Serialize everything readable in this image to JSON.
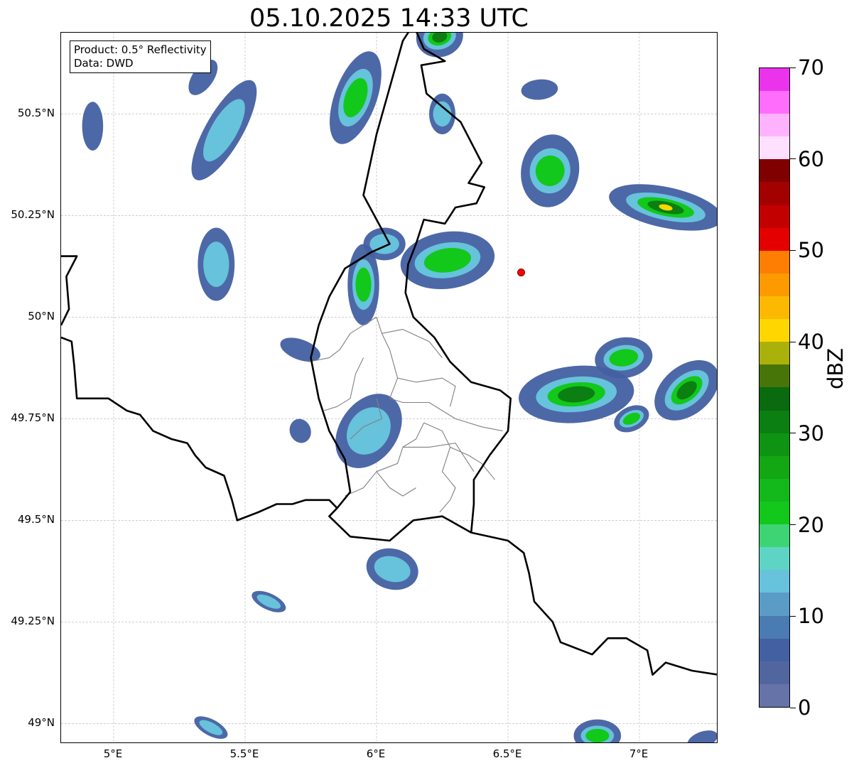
{
  "title": "05.10.2025 14:33 UTC",
  "info": {
    "product": "Product: 0.5° Reflectivity",
    "data": "Data: DWD"
  },
  "axes": {
    "lat_labels": [
      "50.5°N",
      "50.25°N",
      "50°N",
      "49.75°N",
      "49.5°N",
      "49.25°N",
      "49°N"
    ],
    "lon_labels": [
      "5°E",
      "5.5°E",
      "6°E",
      "6.5°E",
      "7°E"
    ],
    "lat_values": [
      50.5,
      50.25,
      50.0,
      49.75,
      49.5,
      49.25,
      49.0
    ],
    "lon_values": [
      5.0,
      5.5,
      6.0,
      6.5,
      7.0
    ],
    "extent": {
      "lon_min": 4.8,
      "lon_max": 7.3,
      "lat_min": 48.95,
      "lat_max": 50.7
    },
    "grid": true
  },
  "colorbar": {
    "unit": "dBZ",
    "tick_labels": [
      "0",
      "10",
      "20",
      "30",
      "40",
      "50",
      "60",
      "70"
    ],
    "tick_values": [
      0,
      10,
      20,
      30,
      40,
      50,
      60,
      70
    ],
    "range": [
      0,
      70
    ],
    "colors": [
      "#6673a8",
      "#51669f",
      "#4360a2",
      "#4a7bb2",
      "#5b9cc7",
      "#67c2dc",
      "#5ed5c4",
      "#3dd474",
      "#12c81a",
      "#13b81a",
      "#12a713",
      "#0e9313",
      "#0b7f12",
      "#096a0e",
      "#487508",
      "#abb10b",
      "#fed700",
      "#fdb901",
      "#fd9a00",
      "#fd7e02",
      "#e50000",
      "#c20000",
      "#a30000",
      "#800000",
      "#ffe1ff",
      "#ffb3fe",
      "#ff6dfd",
      "#eb33ee"
    ]
  },
  "station": {
    "lat": 50.11,
    "lon": 6.55,
    "color": "#ff0000"
  },
  "echoes": [
    {
      "lon": 6.24,
      "lat": 50.69,
      "rx": 0.09,
      "ry": 0.05,
      "angle": -15,
      "dbz": 28
    },
    {
      "lon": 5.34,
      "lat": 50.59,
      "rx": 0.04,
      "ry": 0.05,
      "angle": 35,
      "dbz": 8
    },
    {
      "lon": 4.92,
      "lat": 50.47,
      "rx": 0.04,
      "ry": 0.06,
      "angle": 0,
      "dbz": 10
    },
    {
      "lon": 5.42,
      "lat": 50.46,
      "rx": 0.07,
      "ry": 0.14,
      "angle": 30,
      "dbz": 14
    },
    {
      "lon": 5.92,
      "lat": 50.54,
      "rx": 0.08,
      "ry": 0.12,
      "angle": 20,
      "dbz": 22
    },
    {
      "lon": 6.25,
      "lat": 50.5,
      "rx": 0.05,
      "ry": 0.05,
      "angle": 0,
      "dbz": 12
    },
    {
      "lon": 6.62,
      "lat": 50.56,
      "rx": 0.07,
      "ry": 0.025,
      "angle": -5,
      "dbz": 8
    },
    {
      "lon": 6.66,
      "lat": 50.36,
      "rx": 0.11,
      "ry": 0.09,
      "angle": 10,
      "dbz": 20
    },
    {
      "lon": 7.1,
      "lat": 50.27,
      "rx": 0.22,
      "ry": 0.05,
      "angle": 12,
      "dbz": 32
    },
    {
      "lon": 5.39,
      "lat": 50.13,
      "rx": 0.07,
      "ry": 0.09,
      "angle": 0,
      "dbz": 12
    },
    {
      "lon": 5.95,
      "lat": 50.08,
      "rx": 0.06,
      "ry": 0.1,
      "angle": 0,
      "dbz": 24
    },
    {
      "lon": 6.27,
      "lat": 50.14,
      "rx": 0.18,
      "ry": 0.07,
      "angle": -8,
      "dbz": 26
    },
    {
      "lon": 6.03,
      "lat": 50.18,
      "rx": 0.08,
      "ry": 0.04,
      "angle": 0,
      "dbz": 18
    },
    {
      "lon": 5.71,
      "lat": 49.92,
      "rx": 0.08,
      "ry": 0.025,
      "angle": 20,
      "dbz": 10
    },
    {
      "lon": 5.97,
      "lat": 49.72,
      "rx": 0.11,
      "ry": 0.1,
      "angle": 35,
      "dbz": 16
    },
    {
      "lon": 5.71,
      "lat": 49.72,
      "rx": 0.04,
      "ry": 0.03,
      "angle": -20,
      "dbz": 10
    },
    {
      "lon": 6.76,
      "lat": 49.81,
      "rx": 0.22,
      "ry": 0.07,
      "angle": -5,
      "dbz": 30
    },
    {
      "lon": 6.94,
      "lat": 49.9,
      "rx": 0.11,
      "ry": 0.05,
      "angle": -8,
      "dbz": 20
    },
    {
      "lon": 7.18,
      "lat": 49.82,
      "rx": 0.14,
      "ry": 0.06,
      "angle": -40,
      "dbz": 30
    },
    {
      "lon": 6.97,
      "lat": 49.75,
      "rx": 0.07,
      "ry": 0.03,
      "angle": -25,
      "dbz": 26
    },
    {
      "lon": 6.06,
      "lat": 49.38,
      "rx": 0.1,
      "ry": 0.05,
      "angle": 15,
      "dbz": 16
    },
    {
      "lon": 5.59,
      "lat": 49.3,
      "rx": 0.07,
      "ry": 0.02,
      "angle": 25,
      "dbz": 12
    },
    {
      "lon": 5.37,
      "lat": 48.99,
      "rx": 0.07,
      "ry": 0.02,
      "angle": 28,
      "dbz": 18
    },
    {
      "lon": 6.84,
      "lat": 48.97,
      "rx": 0.09,
      "ry": 0.04,
      "angle": 0,
      "dbz": 20
    },
    {
      "lon": 7.24,
      "lat": 48.96,
      "rx": 0.06,
      "ry": 0.02,
      "angle": -20,
      "dbz": 10
    }
  ],
  "borders": {
    "national": [
      [
        [
          6.14,
          50.72
        ],
        [
          6.18,
          50.66
        ],
        [
          6.26,
          50.63
        ],
        [
          6.17,
          50.62
        ],
        [
          6.19,
          50.55
        ],
        [
          6.32,
          50.48
        ],
        [
          6.4,
          50.38
        ],
        [
          6.35,
          50.33
        ],
        [
          6.41,
          50.32
        ],
        [
          6.38,
          50.28
        ],
        [
          6.3,
          50.27
        ],
        [
          6.26,
          50.23
        ],
        [
          6.18,
          50.24
        ],
        [
          6.15,
          50.18
        ],
        [
          6.12,
          50.13
        ],
        [
          6.11,
          50.06
        ],
        [
          6.14,
          50.0
        ],
        [
          6.22,
          49.95
        ],
        [
          6.28,
          49.89
        ],
        [
          6.36,
          49.84
        ],
        [
          6.47,
          49.82
        ],
        [
          6.51,
          49.8
        ],
        [
          6.5,
          49.72
        ],
        [
          6.43,
          49.66
        ],
        [
          6.37,
          49.6
        ],
        [
          6.37,
          49.54
        ],
        [
          6.36,
          49.47
        ]
      ],
      [
        [
          6.14,
          50.72
        ],
        [
          6.1,
          50.68
        ],
        [
          6.0,
          50.45
        ],
        [
          5.95,
          50.3
        ],
        [
          6.05,
          50.18
        ],
        [
          5.98,
          50.16
        ],
        [
          5.88,
          50.12
        ],
        [
          5.82,
          50.05
        ],
        [
          5.78,
          49.98
        ],
        [
          5.75,
          49.9
        ],
        [
          5.78,
          49.8
        ],
        [
          5.82,
          49.72
        ],
        [
          5.88,
          49.65
        ],
        [
          5.9,
          49.57
        ],
        [
          5.85,
          49.53
        ],
        [
          5.82,
          49.51
        ],
        [
          5.9,
          49.46
        ],
        [
          6.05,
          49.45
        ],
        [
          6.14,
          49.5
        ],
        [
          6.25,
          49.51
        ],
        [
          6.36,
          49.47
        ],
        [
          6.5,
          49.45
        ],
        [
          6.56,
          49.42
        ],
        [
          6.58,
          49.37
        ],
        [
          6.6,
          49.3
        ],
        [
          6.67,
          49.25
        ],
        [
          6.7,
          49.2
        ],
        [
          6.82,
          49.17
        ],
        [
          6.88,
          49.21
        ],
        [
          6.95,
          49.21
        ],
        [
          7.03,
          49.18
        ],
        [
          7.05,
          49.12
        ],
        [
          7.1,
          49.15
        ],
        [
          7.2,
          49.13
        ],
        [
          7.3,
          49.12
        ]
      ],
      [
        [
          4.8,
          50.15
        ],
        [
          4.86,
          50.15
        ],
        [
          4.82,
          50.1
        ],
        [
          4.83,
          50.02
        ],
        [
          4.8,
          49.98
        ]
      ],
      [
        [
          4.8,
          49.95
        ],
        [
          4.84,
          49.94
        ],
        [
          4.85,
          49.88
        ],
        [
          4.86,
          49.8
        ],
        [
          4.92,
          49.8
        ],
        [
          4.98,
          49.8
        ],
        [
          5.05,
          49.77
        ],
        [
          5.1,
          49.76
        ],
        [
          5.15,
          49.72
        ],
        [
          5.22,
          49.7
        ],
        [
          5.28,
          49.69
        ],
        [
          5.31,
          49.66
        ],
        [
          5.35,
          49.63
        ],
        [
          5.42,
          49.61
        ],
        [
          5.45,
          49.55
        ],
        [
          5.47,
          49.5
        ],
        [
          5.55,
          49.52
        ],
        [
          5.62,
          49.54
        ],
        [
          5.68,
          49.54
        ],
        [
          5.73,
          49.55
        ],
        [
          5.82,
          49.55
        ],
        [
          5.85,
          49.53
        ]
      ]
    ],
    "regional": [
      [
        [
          6.0,
          50.0
        ],
        [
          5.95,
          49.98
        ],
        [
          5.9,
          49.96
        ],
        [
          5.86,
          49.92
        ],
        [
          5.82,
          49.9
        ],
        [
          5.74,
          49.89
        ]
      ],
      [
        [
          6.0,
          50.0
        ],
        [
          6.02,
          49.96
        ],
        [
          6.05,
          49.92
        ],
        [
          6.08,
          49.85
        ]
      ],
      [
        [
          6.02,
          49.96
        ],
        [
          6.1,
          49.97
        ],
        [
          6.2,
          49.94
        ],
        [
          6.25,
          49.9
        ]
      ],
      [
        [
          6.08,
          49.85
        ],
        [
          6.05,
          49.8
        ],
        [
          6.1,
          49.79
        ],
        [
          6.2,
          49.79
        ],
        [
          6.25,
          49.77
        ],
        [
          6.3,
          49.75
        ],
        [
          6.4,
          49.73
        ],
        [
          6.48,
          49.72
        ]
      ],
      [
        [
          5.95,
          49.9
        ],
        [
          5.92,
          49.86
        ],
        [
          5.9,
          49.8
        ],
        [
          5.85,
          49.78
        ],
        [
          5.8,
          49.77
        ]
      ],
      [
        [
          6.08,
          49.85
        ],
        [
          6.15,
          49.84
        ],
        [
          6.25,
          49.85
        ],
        [
          6.3,
          49.83
        ],
        [
          6.28,
          49.78
        ]
      ],
      [
        [
          6.0,
          49.8
        ],
        [
          6.02,
          49.75
        ],
        [
          5.95,
          49.73
        ],
        [
          5.9,
          49.7
        ]
      ],
      [
        [
          6.18,
          49.74
        ],
        [
          6.15,
          49.7
        ],
        [
          6.1,
          49.68
        ],
        [
          6.08,
          49.64
        ],
        [
          6.0,
          49.62
        ],
        [
          5.95,
          49.58
        ],
        [
          5.88,
          49.56
        ]
      ],
      [
        [
          6.18,
          49.74
        ],
        [
          6.25,
          49.72
        ],
        [
          6.28,
          49.68
        ],
        [
          6.25,
          49.62
        ],
        [
          6.3,
          49.58
        ],
        [
          6.28,
          49.55
        ],
        [
          6.24,
          49.52
        ]
      ],
      [
        [
          6.1,
          49.68
        ],
        [
          6.2,
          49.68
        ],
        [
          6.3,
          49.69
        ],
        [
          6.37,
          49.62
        ]
      ],
      [
        [
          6.28,
          49.68
        ],
        [
          6.35,
          49.66
        ],
        [
          6.4,
          49.64
        ],
        [
          6.45,
          49.6
        ]
      ],
      [
        [
          6.0,
          49.62
        ],
        [
          6.05,
          49.58
        ],
        [
          6.1,
          49.56
        ],
        [
          6.15,
          49.58
        ]
      ]
    ]
  }
}
